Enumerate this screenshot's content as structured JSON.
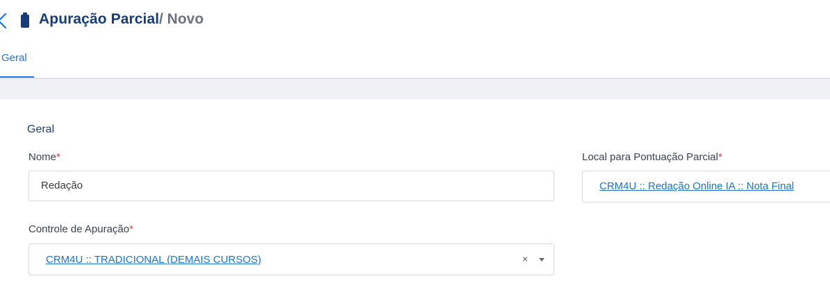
{
  "header": {
    "title": "Apuração Parcial",
    "subtitle": "/ Novo",
    "icons": {
      "back": "chevron-left-icon",
      "module": "battery-icon"
    }
  },
  "tabs": [
    {
      "label": "Geral",
      "active": true
    }
  ],
  "form": {
    "section_title": "Geral",
    "nome": {
      "label": "Nome",
      "required_mark": "*",
      "value": "Redação"
    },
    "local": {
      "label": "Local para Pontuação Parcial",
      "required_mark": "*",
      "value": "CRM4U :: Redação Online IA :: Nota Final"
    },
    "controle": {
      "label": "Controle de Apuração",
      "required_mark": "*",
      "value": "CRM4U :: TRADICIONAL (DEMAIS CURSOS)",
      "clear_symbol": "×"
    }
  },
  "colors": {
    "brand": "#163d7a",
    "accent": "#1a73e8",
    "required": "#e53935",
    "link": "#1a73c8"
  }
}
